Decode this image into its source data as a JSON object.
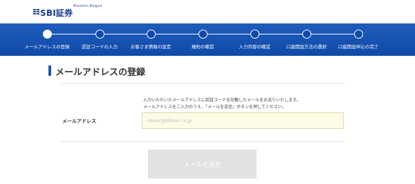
{
  "header": {
    "logo_sub": "Nisshin-Kogyo",
    "logo_text": "SBI証券"
  },
  "steps": [
    {
      "label": "メールアドレスの登録",
      "active": true
    },
    {
      "label": "認証コードの入力",
      "active": false
    },
    {
      "label": "お客さま情報の設定",
      "active": false
    },
    {
      "label": "規約の確認",
      "active": false
    },
    {
      "label": "入力内容の確認",
      "active": false
    },
    {
      "label": "口座開設方法の選択",
      "active": false
    },
    {
      "label": "口座開設申込の完了",
      "active": false
    }
  ],
  "main": {
    "title": "メールアドレスの登録",
    "note_line1": "入力いただいたメールアドレスに認証コードを記載したメールをお送りいたします。",
    "note_line2": "メールアドレスをご入力のうえ、「メールを送信」ボタンを押してください。",
    "email_label": "メールアドレス",
    "email_value": "",
    "email_placeholder": "sbisec@sbisec.co.jp",
    "send_label": "メールを送信"
  },
  "colors": {
    "brand": "#1a3f8f",
    "band": "#0f4aa8",
    "input_bg": "#fcfbe6",
    "button_disabled": "#e2e2e2"
  }
}
